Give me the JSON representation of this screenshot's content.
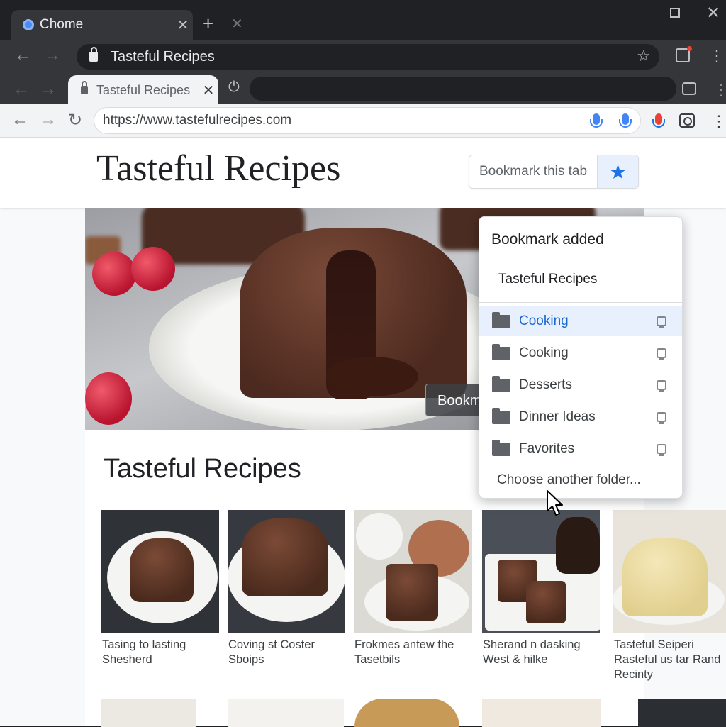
{
  "outer_window": {
    "tab_title": "Chome",
    "omnibox_text": "Tasteful Recipes"
  },
  "inner_window": {
    "tab_title": "Tasteful Recipes",
    "url": "https://www.tastefulrecipes.com"
  },
  "site": {
    "title": "Tasteful Recipes",
    "bookmark_button_label": "Bookmark this tab",
    "hero_chip_text": "Bookm",
    "section_title": "Tasteful Recipes"
  },
  "recipes": [
    {
      "caption": "Tasing to lasting Shesherd"
    },
    {
      "caption": "Coving st Coster Sboips"
    },
    {
      "caption": "Frokmes antew the Tasetbils"
    },
    {
      "caption": "Sherand n dasking West & hilke"
    },
    {
      "caption": "Tasteful Seiperi Rasteful us tar Rand Recinty"
    }
  ],
  "bookmark_popup": {
    "heading": "Bookmark added",
    "name": "Tasteful Recipes",
    "folders": [
      {
        "label": "Cooking",
        "selected": true
      },
      {
        "label": "Cooking",
        "selected": false
      },
      {
        "label": "Desserts",
        "selected": false
      },
      {
        "label": "Dinner Ideas",
        "selected": false
      },
      {
        "label": "Favorites",
        "selected": false
      }
    ],
    "choose_folder": "Choose another folder..."
  },
  "icons": [
    "back-arrow-icon",
    "forward-arrow-icon",
    "reload-icon",
    "lock-icon",
    "star-icon",
    "mic-icon",
    "camera-icon",
    "folder-icon",
    "pin-icon",
    "kebab-menu-icon",
    "close-icon",
    "mouse-cursor-icon"
  ],
  "colors": {
    "accent": "#1a73e8",
    "selected_row": "#e8f0fe",
    "dark_chrome": "#202124"
  }
}
